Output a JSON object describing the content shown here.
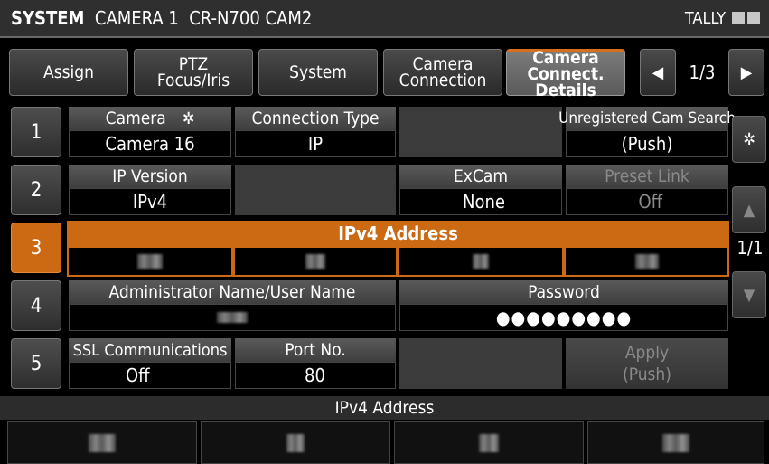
{
  "topbar": {
    "system": "SYSTEM",
    "camera": "CAMERA 1",
    "model": "CR-N700 CAM2",
    "tally": "TALLY"
  },
  "tabs": [
    {
      "label": "Assign"
    },
    {
      "label": "PTZ\nFocus/Iris"
    },
    {
      "label": "System"
    },
    {
      "label": "Camera\nConnection"
    },
    {
      "label": "Camera\nConnect. Details",
      "active": true
    }
  ],
  "pager": {
    "prev": "◀",
    "indicator": "1/3",
    "next": "▶"
  },
  "rows": [
    {
      "num": "1"
    },
    {
      "num": "2"
    },
    {
      "num": "3"
    },
    {
      "num": "4"
    },
    {
      "num": "5"
    }
  ],
  "row1": {
    "camera_label": "Camera",
    "camera_value": "Camera 16",
    "conn_type_label": "Connection Type",
    "conn_type_value": "IP",
    "unreg_label": "Unregistered Cam Search",
    "unreg_value": "(Push)"
  },
  "row2": {
    "ip_version_label": "IP Version",
    "ip_version_value": "IPv4",
    "excam_label": "ExCam",
    "excam_value": "None",
    "preset_label": "Preset Link",
    "preset_value": "Off"
  },
  "row3": {
    "ipv4_label": "IPv4 Address"
  },
  "row4": {
    "admin_label": "Administrator Name/User Name",
    "password_label": "Password",
    "password_value": "●●●●●●●●●"
  },
  "row5": {
    "ssl_label": "SSL Communications",
    "ssl_value": "Off",
    "port_label": "Port No.",
    "port_value": "80",
    "apply_line1": "Apply",
    "apply_line2": "(Push)"
  },
  "side": {
    "gear": "gear",
    "up": "▲",
    "indicator": "1/1",
    "down": "▼"
  },
  "bottom": {
    "label": "IPv4 Address"
  },
  "colors": {
    "accent": "#cc6a14",
    "background": "#000000"
  }
}
